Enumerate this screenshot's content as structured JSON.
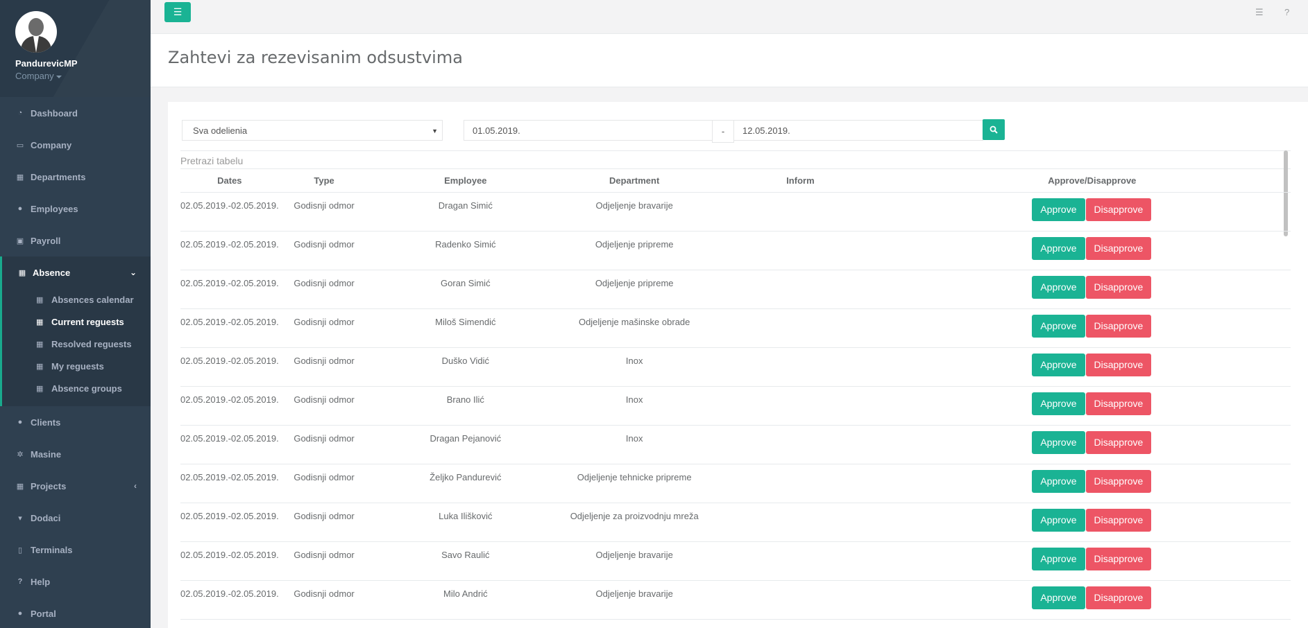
{
  "profile": {
    "name": "PandurevicMP",
    "company": "Company"
  },
  "nav": {
    "dashboard": "Dashboard",
    "company": "Company",
    "departments": "Departments",
    "employees": "Employees",
    "payroll": "Payroll",
    "absence": "Absence",
    "absence_sub": [
      "Absences calendar",
      "Current reguests",
      "Resolved reguests",
      "My reguests",
      "Absence groups"
    ],
    "clients": "Clients",
    "masine": "Masine",
    "projects": "Projects",
    "dodaci": "Dodaci",
    "terminals": "Terminals",
    "help": "Help",
    "portal": "Portal"
  },
  "topbar": {
    "help": "?"
  },
  "page_title": "Zahtevi za rezevisanim odsustvima",
  "filters": {
    "department": "Sva odelienia",
    "date_from": "01.05.2019.",
    "date_sep": "-",
    "date_to": "12.05.2019."
  },
  "table_search_placeholder": "Pretrazi tabelu",
  "table": {
    "headers": [
      "Dates",
      "Type",
      "Employee",
      "Department",
      "Inform",
      "Approve/Disapprove"
    ],
    "approve_label": "Approve",
    "disapprove_label": "Disapprove",
    "rows": [
      {
        "dates": "02.05.2019.-02.05.2019.",
        "type": "Godisnji odmor",
        "employee": "Dragan Simić",
        "department": "Odjeljenje bravarije",
        "inform": ""
      },
      {
        "dates": "02.05.2019.-02.05.2019.",
        "type": "Godisnji odmor",
        "employee": "Radenko Simić",
        "department": "Odjeljenje pripreme",
        "inform": ""
      },
      {
        "dates": "02.05.2019.-02.05.2019.",
        "type": "Godisnji odmor",
        "employee": "Goran Simić",
        "department": "Odjeljenje pripreme",
        "inform": ""
      },
      {
        "dates": "02.05.2019.-02.05.2019.",
        "type": "Godisnji odmor",
        "employee": "Miloš Simendić",
        "department": "Odjeljenje mašinske obrade",
        "inform": ""
      },
      {
        "dates": "02.05.2019.-02.05.2019.",
        "type": "Godisnji odmor",
        "employee": "Duško Vidić",
        "department": "Inox",
        "inform": ""
      },
      {
        "dates": "02.05.2019.-02.05.2019.",
        "type": "Godisnji odmor",
        "employee": "Brano Ilić",
        "department": "Inox",
        "inform": ""
      },
      {
        "dates": "02.05.2019.-02.05.2019.",
        "type": "Godisnji odmor",
        "employee": "Dragan Pejanović",
        "department": "Inox",
        "inform": ""
      },
      {
        "dates": "02.05.2019.-02.05.2019.",
        "type": "Godisnji odmor",
        "employee": "Željko Pandurević",
        "department": "Odjeljenje tehnicke pripreme",
        "inform": ""
      },
      {
        "dates": "02.05.2019.-02.05.2019.",
        "type": "Godisnji odmor",
        "employee": "Luka Ilišković",
        "department": "Odjeljenje za proizvodnju mreža",
        "inform": ""
      },
      {
        "dates": "02.05.2019.-02.05.2019.",
        "type": "Godisnji odmor",
        "employee": "Savo Raulić",
        "department": "Odjeljenje bravarije",
        "inform": ""
      },
      {
        "dates": "02.05.2019.-02.05.2019.",
        "type": "Godisnji odmor",
        "employee": "Milo Andrić",
        "department": "Odjeljenje bravarije",
        "inform": ""
      }
    ]
  },
  "colors": {
    "sidebar": "#2f4050",
    "accent": "#1ab394",
    "danger": "#ed5565"
  }
}
